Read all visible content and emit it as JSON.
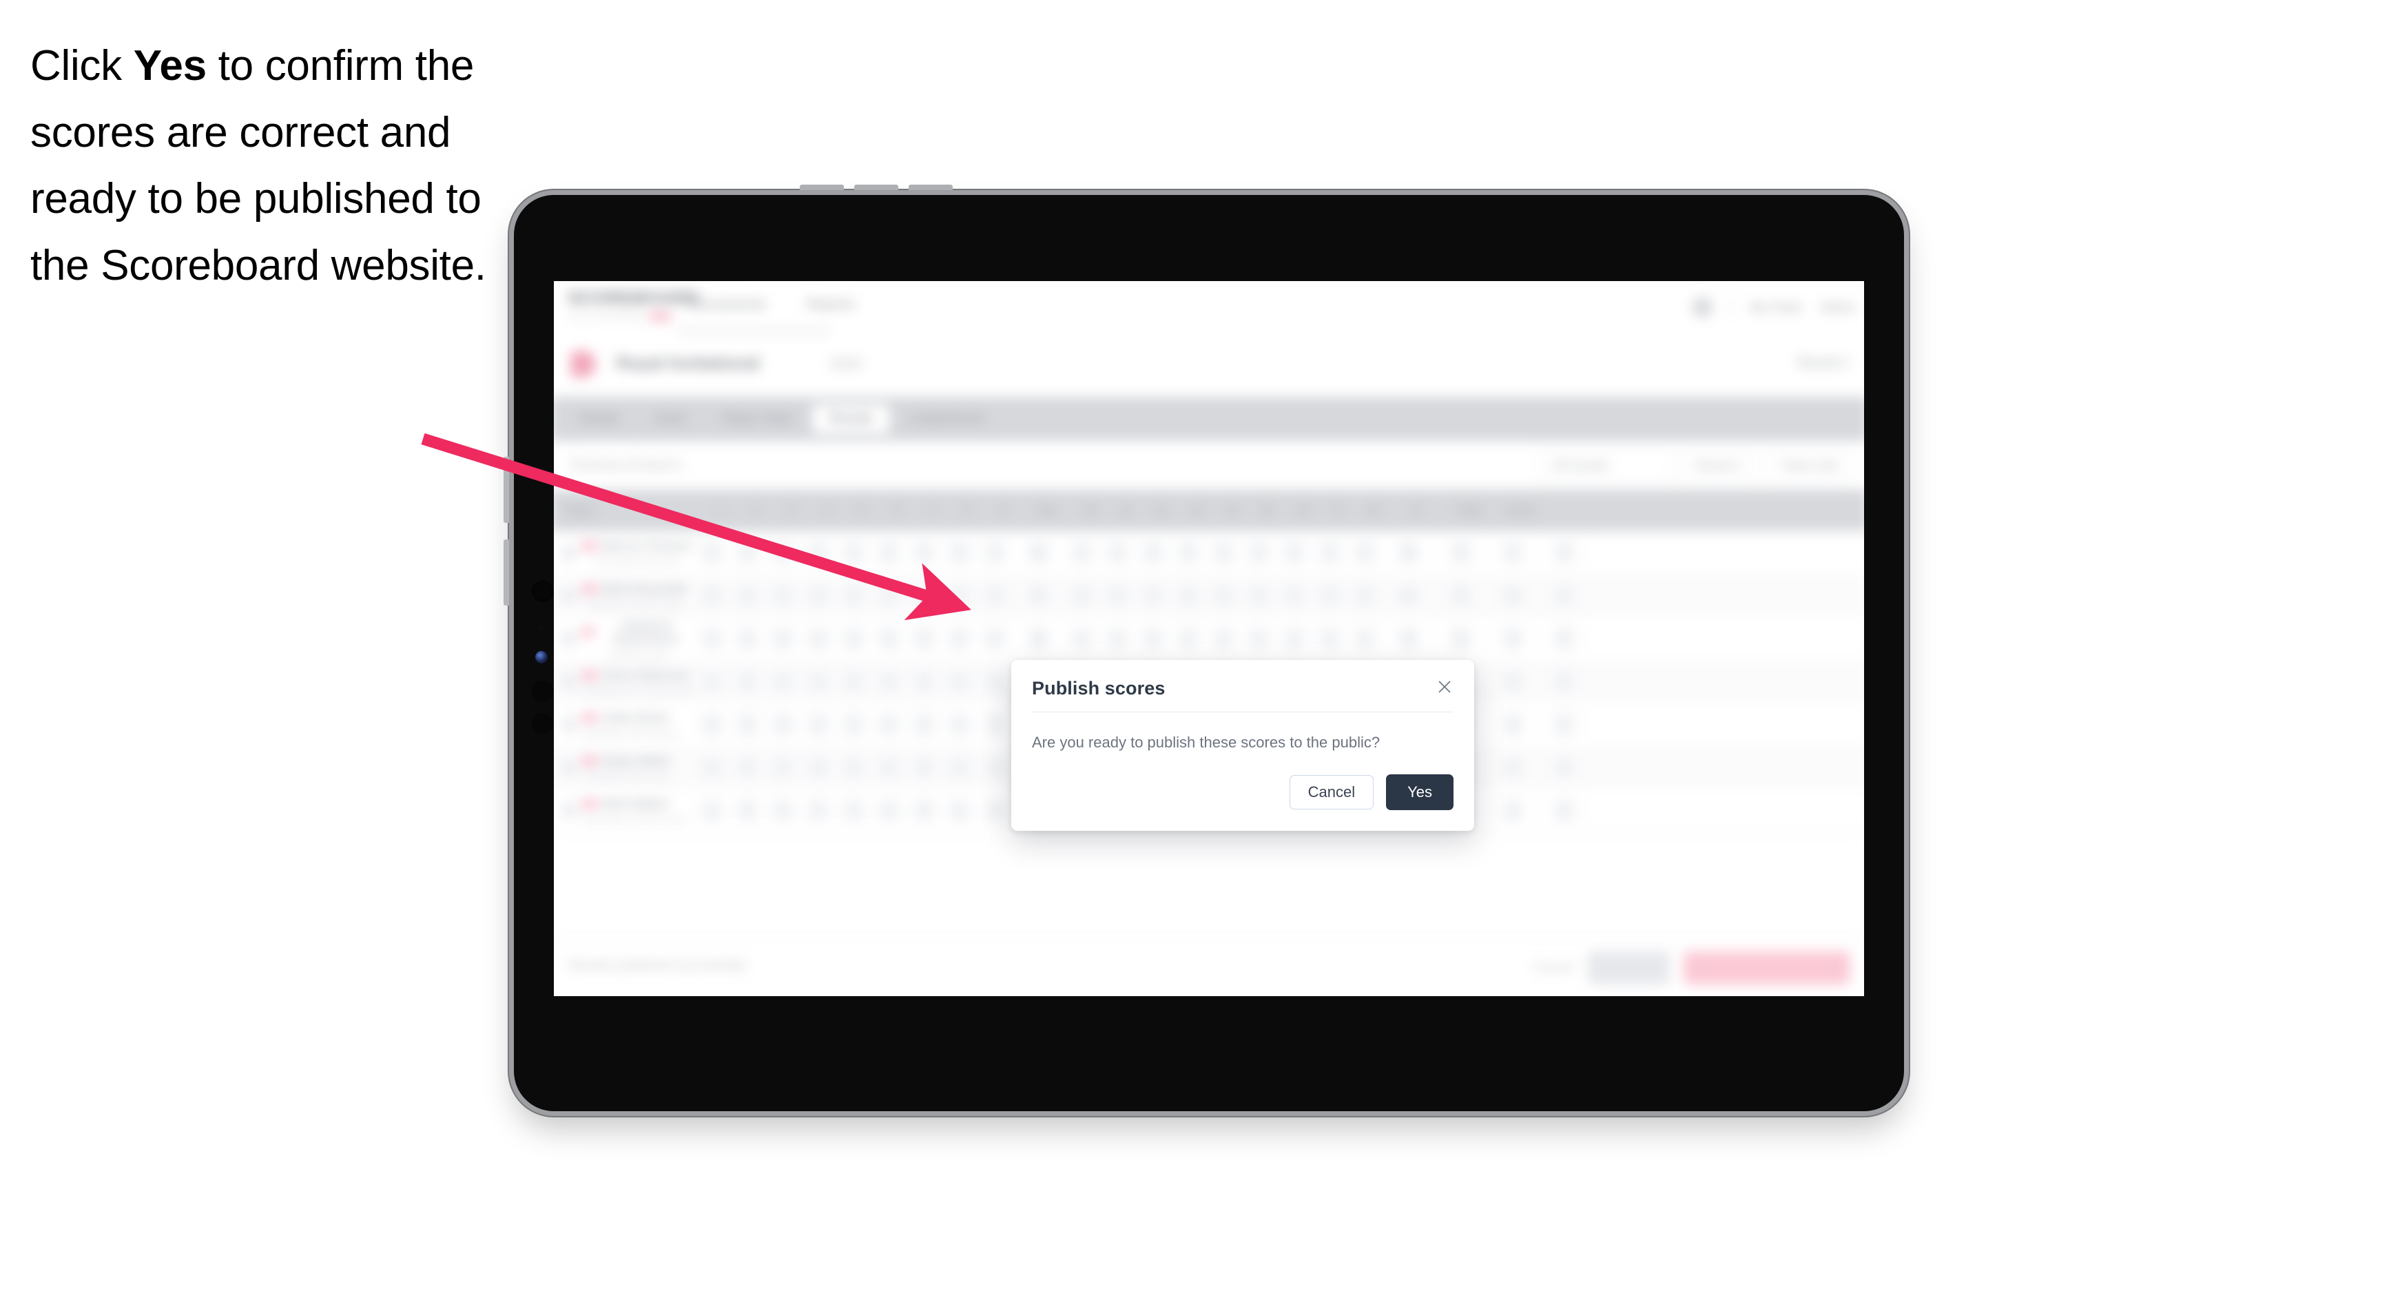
{
  "caption": {
    "before": "Click ",
    "emphasis": "Yes",
    "after": " to confirm the scores are correct and ready to be published to the Scoreboard website."
  },
  "colors": {
    "arrow": "#ee2a5f",
    "primary_button": "#2b3647",
    "accent_pink": "#f2a8bc",
    "device_bezel": "#9d9fa2"
  },
  "modal": {
    "title": "Publish scores",
    "message": "Are you ready to publish these scores to the public?",
    "close_icon": "close-icon",
    "cancel_label": "Cancel",
    "confirm_label": "Yes"
  },
  "app": {
    "topnav": {
      "logo": "SCOREBOARD",
      "logo_sub": "LIVE SCORING",
      "links": [
        "Tournaments",
        "Reports"
      ],
      "right_links": [
        "My Clubs",
        "Admin"
      ]
    },
    "event": {
      "title": "Royal Invitational",
      "subtitle": "2024",
      "right": "Round 1"
    },
    "tabs": [
      {
        "label": "Details",
        "active": false
      },
      {
        "label": "Draw",
        "active": false
      },
      {
        "label": "Player Stats",
        "active": false
      },
      {
        "label": "Results",
        "active": true
      },
      {
        "label": "Leaderboard",
        "active": false
      }
    ],
    "filters": {
      "left_label": "Showing all players",
      "chips": [
        "All rounds",
        "Round 1",
        "Team only"
      ]
    },
    "table": {
      "columns": [
        "Player",
        "1",
        "2",
        "3",
        "4",
        "5",
        "6",
        "7",
        "8",
        "9",
        "Out",
        "10",
        "11",
        "12",
        "13",
        "14",
        "15",
        "16",
        "17",
        "18",
        "In",
        "Total",
        "Score"
      ],
      "rows": [
        {
          "name": "Marcus Tomson",
          "team": "Riverside Golf Club",
          "scores": [
            "4",
            "5",
            "4",
            "3",
            "5",
            "4",
            "4",
            "3",
            "4",
            "36",
            "4",
            "5",
            "3",
            "4",
            "4",
            "5",
            "4",
            "3",
            "4",
            "36",
            "72",
            "-1",
            "E"
          ]
        },
        {
          "name": "Elliot Reynolds",
          "team": "Hillcrest Country Club",
          "scores": [
            "5",
            "4",
            "4",
            "4",
            "4",
            "4",
            "5",
            "3",
            "4",
            "37",
            "4",
            "4",
            "4",
            "5",
            "3",
            "4",
            "4",
            "4",
            "5",
            "37",
            "74",
            "+2",
            "E"
          ]
        },
        {
          "name": "Cameron Richardson",
          "team": "Oakfield Links",
          "scores": [
            "4",
            "4",
            "5",
            "3",
            "4",
            "5",
            "4",
            "4",
            "3",
            "36",
            "5",
            "4",
            "4",
            "4",
            "4",
            "3",
            "5",
            "4",
            "4",
            "37",
            "73",
            "+1",
            "E"
          ]
        },
        {
          "name": "Chris Patterson",
          "team": "Westbourne Country Club",
          "scores": [
            "4",
            "5",
            "4",
            "4",
            "3",
            "4",
            "4",
            "5",
            "4",
            "37",
            "4",
            "4",
            "5",
            "4",
            "5",
            "4",
            "3",
            "4",
            "4",
            "37",
            "74",
            "+2",
            "E"
          ]
        },
        {
          "name": "Aiden Brant",
          "team": "Northlake Golf Society",
          "scores": [
            "5",
            "4",
            "3",
            "4",
            "4",
            "4",
            "4",
            "4",
            "5",
            "37",
            "4",
            "5",
            "4",
            "3",
            "4",
            "4",
            "4",
            "5",
            "4",
            "37",
            "74",
            "+2",
            "E"
          ]
        },
        {
          "name": "Nolan Webb",
          "team": "Southfield Golf Club",
          "scores": [
            "4",
            "4",
            "4",
            "5",
            "4",
            "3",
            "5",
            "4",
            "4",
            "37",
            "4",
            "4",
            "3",
            "4",
            "5",
            "4",
            "4",
            "4",
            "4",
            "36",
            "73",
            "+1",
            "E"
          ]
        },
        {
          "name": "Beth Walker",
          "team": "Greenvale Country Club",
          "scores": [
            "4",
            "5",
            "4",
            "4",
            "4",
            "4",
            "3",
            "4",
            "4",
            "36",
            "5",
            "4",
            "4",
            "4",
            "3",
            "5",
            "4",
            "4",
            "4",
            "37",
            "73",
            "+1",
            "E"
          ]
        }
      ]
    },
    "footer": {
      "note": "Results published successfully",
      "link": "Cancel",
      "secondary_button": "Save",
      "primary_button": "Publish to Scoreboard"
    }
  }
}
